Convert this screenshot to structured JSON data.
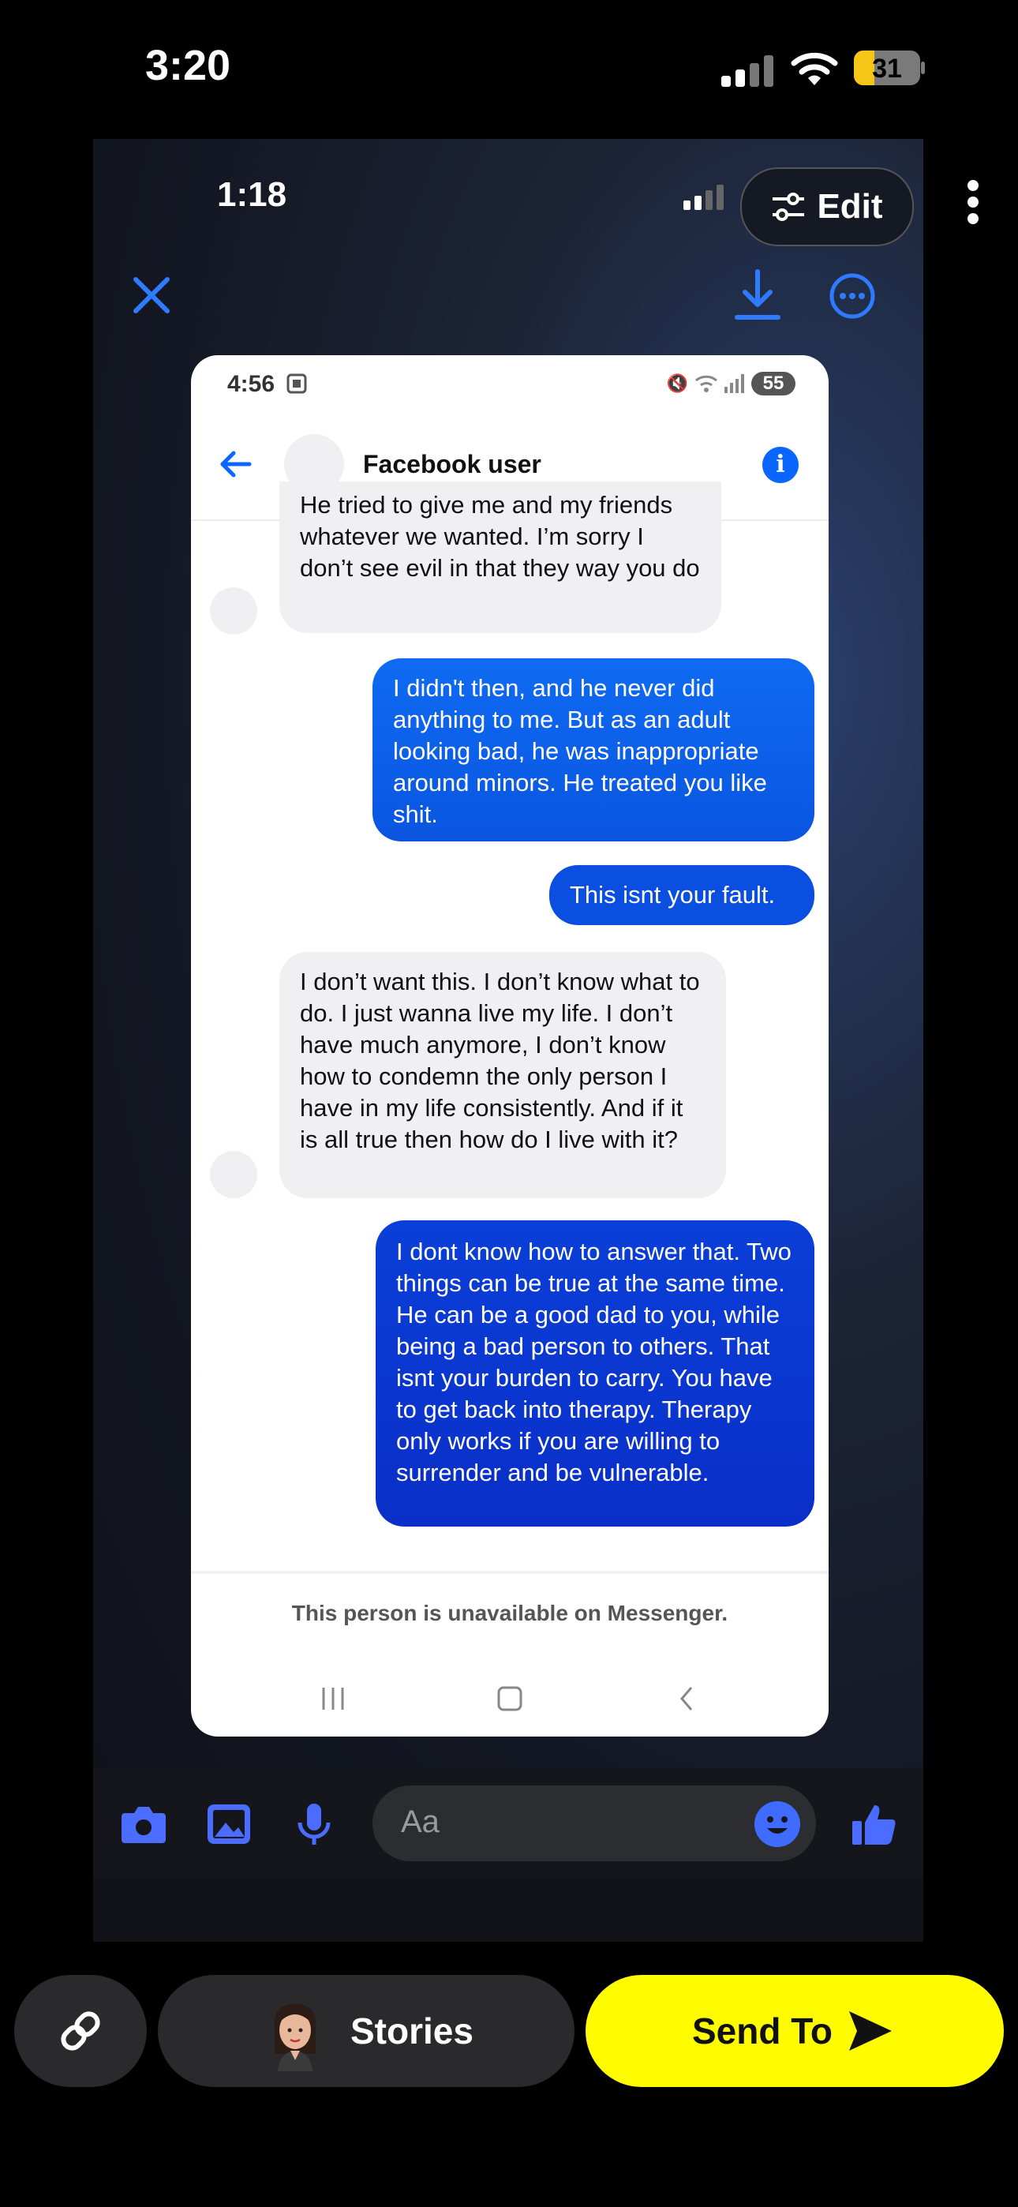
{
  "ios_status": {
    "time": "3:20",
    "battery": "31"
  },
  "snap": {
    "inner_time": "1:18",
    "edit_label": "Edit"
  },
  "screenshot": {
    "time": "4:56",
    "battery": "55",
    "contact_name": "Facebook user",
    "messages": [
      {
        "from": "them",
        "text": "He tried to give me and my friends whatever we wanted. I’m sorry I don’t see evil in that they way you do"
      },
      {
        "from": "me",
        "text": "I didn't then, and he never did anything to me. But as an adult looking bad, he was inappropriate around minors. He treated you like shit."
      },
      {
        "from": "me",
        "text": "This isnt your fault."
      },
      {
        "from": "them",
        "text": "I don’t want this. I don’t know what to do. I just wanna live my life. I don’t have much anymore, I don’t know how to condemn the only person I have in my life consistently. And if it is all true then how do I live with it?"
      },
      {
        "from": "me",
        "text": "I dont know how to answer that. Two things can be true at the same time. He can be a good dad to you,  while being a bad person to others. That isnt your burden to carry. You have to get back into therapy. Therapy only works if you are willing to surrender and be vulnerable."
      }
    ],
    "unavailable_notice": "This person is unavailable on Messenger."
  },
  "compose": {
    "placeholder": "Aa"
  },
  "bottom_bar": {
    "stories_label": "Stories",
    "send_label": "Send To"
  },
  "colors": {
    "accent_blue": "#0a66ff",
    "snap_yellow": "#fffc00",
    "compose_icon": "#4a6cff"
  },
  "icons": [
    "close-icon",
    "download-icon",
    "more-icon",
    "camera-icon",
    "image-icon",
    "mic-icon",
    "emoji-icon",
    "like-icon",
    "link-icon",
    "send-arrow-icon",
    "info-icon",
    "back-arrow-icon"
  ]
}
